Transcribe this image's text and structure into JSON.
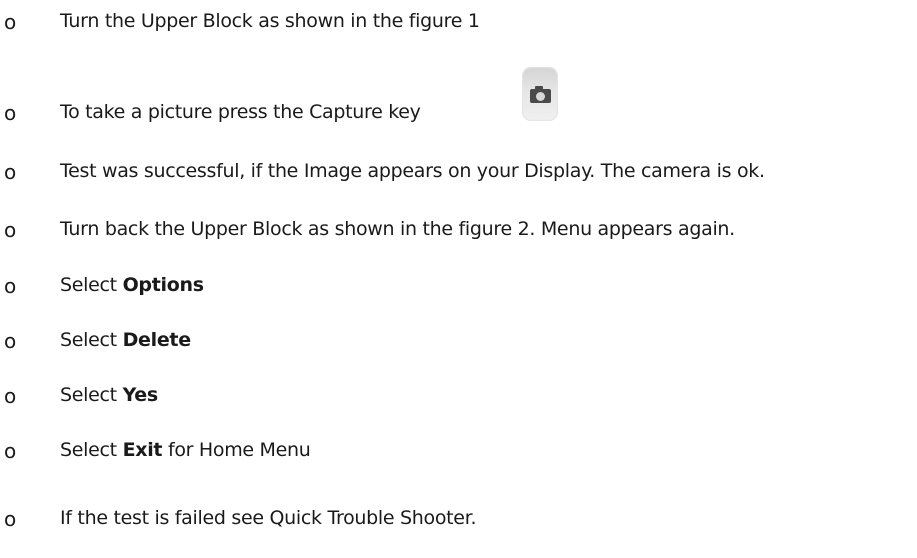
{
  "bullet_glyph": "o",
  "items": [
    {
      "text": "Turn the Upper Block as shown in the figure 1"
    },
    {
      "text": "To take a picture press the Capture key"
    },
    {
      "text": "Test was successful, if the Image appears on your Display. The camera is ok."
    },
    {
      "text": "Turn back the Upper Block as shown in the figure 2. Menu appears again."
    },
    {
      "prefix": "Select ",
      "bold": "Options"
    },
    {
      "prefix": "Select ",
      "bold": "Delete"
    },
    {
      "prefix": "Select ",
      "bold": "Yes"
    },
    {
      "prefix": "Select ",
      "bold": "Exit",
      "suffix": " for Home Menu"
    },
    {
      "text": "If the test is failed see Quick Trouble Shooter."
    }
  ],
  "icons": {
    "capture_key": "camera-capture-key-icon"
  }
}
